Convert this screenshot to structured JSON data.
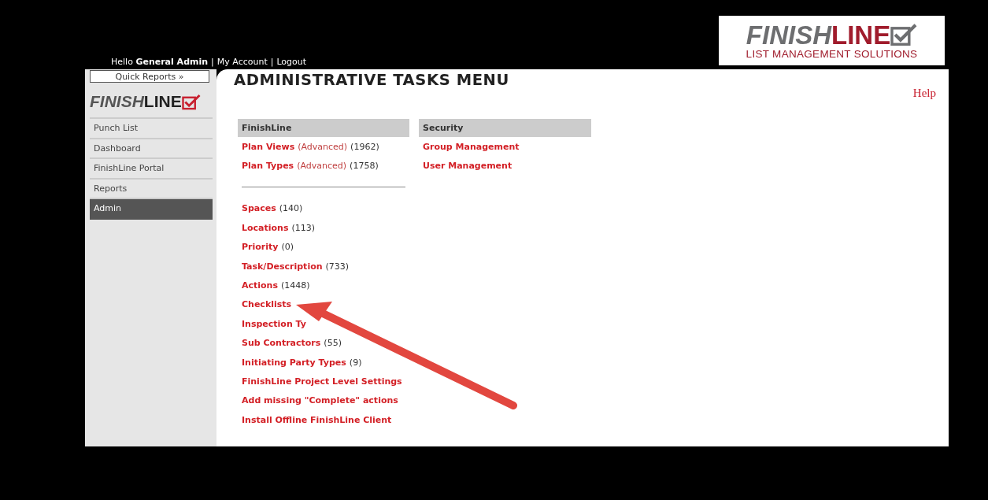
{
  "header": {
    "greeting": "Hello **General Admin**",
    "links": [
      {
        "label": "My Account"
      },
      {
        "label": "Logout"
      }
    ],
    "separator": "|"
  },
  "brand_logo": {
    "part_1": "FINISH",
    "part_2": "LINE",
    "tagline": "LIST MANAGEMENT SOLUTIONS"
  },
  "sidebar": {
    "quick_reports": "Quick Reports »",
    "logo": {
      "part_1": "FINISH",
      "part_2": "LINE"
    },
    "items": [
      {
        "label": "Punch List",
        "selected": false
      },
      {
        "label": "Dashboard",
        "selected": false
      },
      {
        "label": "FinishLine Portal",
        "selected": false
      },
      {
        "label": "Reports",
        "selected": false
      },
      {
        "label": "Admin",
        "selected": true
      }
    ]
  },
  "content": {
    "title": "ADMINISTRATIVE TASKS MENU",
    "help": "Help",
    "sections": [
      {
        "heading": "FinishLine",
        "items": [
          {
            "kind": "link",
            "label": "Plan Views",
            "note": "(Advanced)",
            "count": "(1962)"
          },
          {
            "kind": "link",
            "label": "Plan Types",
            "note": "(Advanced)",
            "count": "(1758)"
          },
          {
            "kind": "divider"
          },
          {
            "kind": "link",
            "label": "Spaces",
            "count": "(140)"
          },
          {
            "kind": "link",
            "label": "Locations",
            "count": "(113)"
          },
          {
            "kind": "link",
            "label": "Priority",
            "count": "(0)"
          },
          {
            "kind": "link",
            "label": "Task/Description",
            "count": "(733)"
          },
          {
            "kind": "link",
            "label": "Actions",
            "count": "(1448)"
          },
          {
            "kind": "link",
            "label": "Checklists"
          },
          {
            "kind": "link",
            "label": "Inspection Ty"
          },
          {
            "kind": "link",
            "label": "Sub Contractors",
            "count": "(55)"
          },
          {
            "kind": "link",
            "label": "Initiating Party Types",
            "count": "(9)"
          },
          {
            "kind": "link",
            "label": "FinishLine Project Level Settings"
          },
          {
            "kind": "link",
            "label": "Add missing \"Complete\" actions"
          },
          {
            "kind": "link",
            "label": "Install Offline FinishLine Client"
          }
        ]
      },
      {
        "heading": "Security",
        "items": [
          {
            "kind": "link",
            "label": "Group Management"
          },
          {
            "kind": "link",
            "label": "User Management"
          }
        ]
      }
    ]
  }
}
